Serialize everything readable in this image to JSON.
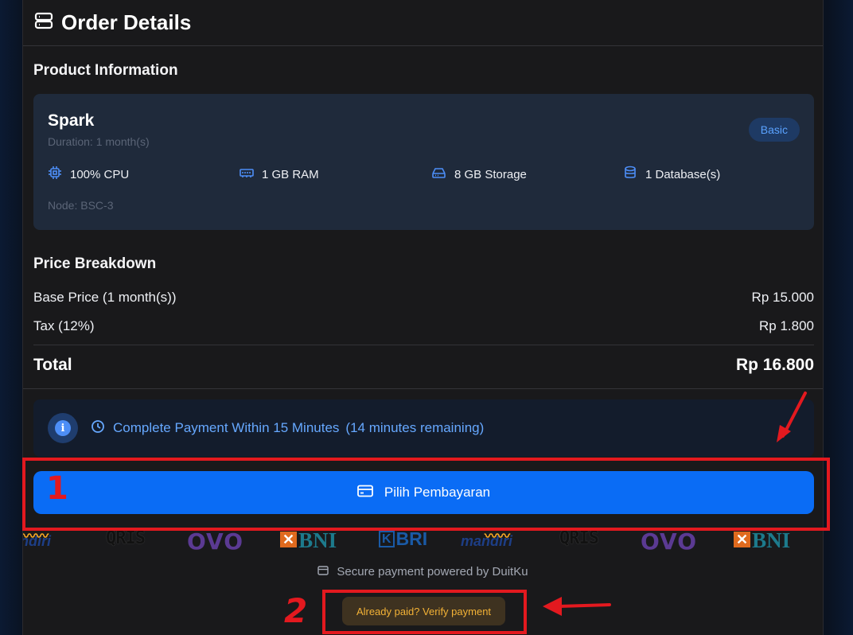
{
  "header": {
    "title": "Order Details"
  },
  "product_info": {
    "section_title": "Product Information",
    "name": "Spark",
    "duration": "Duration: 1 month(s)",
    "badge": "Basic",
    "specs": [
      {
        "icon": "cpu-icon",
        "label": "100% CPU"
      },
      {
        "icon": "ram-icon",
        "label": "1 GB RAM"
      },
      {
        "icon": "storage-icon",
        "label": "8 GB Storage"
      },
      {
        "icon": "database-icon",
        "label": "1 Database(s)"
      }
    ],
    "node": "Node: BSC-3"
  },
  "price": {
    "section_title": "Price Breakdown",
    "rows": [
      {
        "label": "Base Price (1 month(s))",
        "value": "Rp 15.000"
      },
      {
        "label": "Tax (12%)",
        "value": "Rp 1.800"
      }
    ],
    "total_label": "Total",
    "total_value": "Rp 16.800"
  },
  "notice": {
    "text": "Complete Payment Within 15 Minutes",
    "remaining": "(14 minutes remaining)"
  },
  "pay_button": "Pilih Pembayaran",
  "logos": [
    "mandiri",
    "QRIS",
    "OVO",
    "BNI",
    "BRI",
    "mandiri",
    "QRIS",
    "OVO",
    "BNI"
  ],
  "secure_text": "Secure payment powered by DuitKu",
  "verify_button": "Already paid? Verify payment",
  "annotations": {
    "label_1": "1",
    "label_2": "2"
  },
  "colors": {
    "accent": "#0a6cf5",
    "annotation": "#e3191f",
    "verify_text": "#f3b236"
  }
}
